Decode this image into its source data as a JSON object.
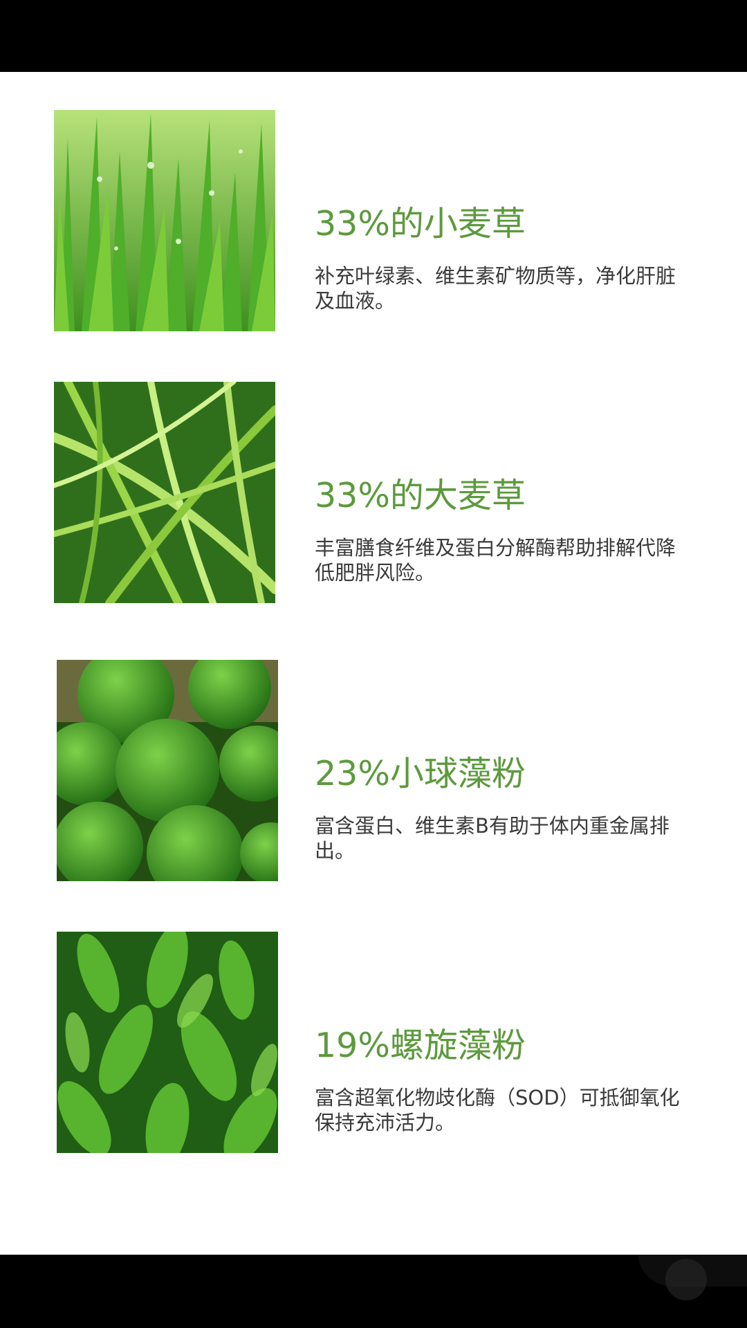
{
  "items": [
    {
      "title": "33%的小麦草",
      "desc": "补充叶绿素、维生素矿物质等，净化肝脏及血液。",
      "image": "wheatgrass-with-dew"
    },
    {
      "title": "33%的大麦草",
      "desc": "丰富膳食纤维及蛋白分解酶帮助排解代降低肥胖风险。",
      "image": "barley-grass"
    },
    {
      "title": "23%小球藻粉",
      "desc": "富含蛋白、维生素B有助于体内重金属排出。",
      "image": "moss-balls"
    },
    {
      "title": "19%螺旋藻粉",
      "desc": "富含超氧化物歧化酶（SOD）可抵御氧化保持充沛活力。",
      "image": "green-leaves"
    }
  ],
  "colors": {
    "title_green": "#5c9a3c",
    "text": "#3a3a3a"
  }
}
